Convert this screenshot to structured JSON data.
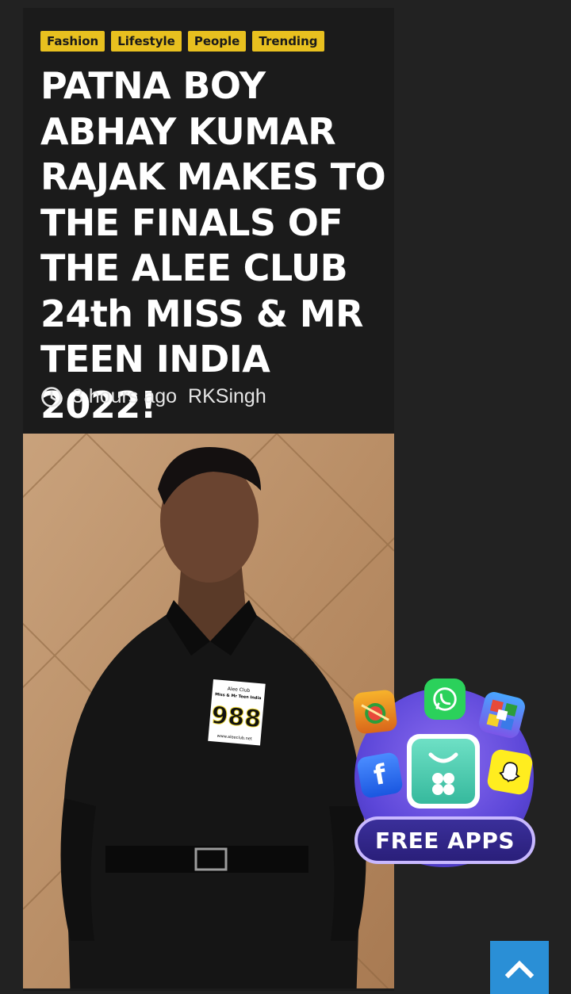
{
  "article": {
    "categories": [
      "Fashion",
      "Lifestyle",
      "People",
      "Trending"
    ],
    "title": "PATNA BOY ABHAY KUMAR RAJAK MAKES TO THE FINALS OF THE ALEE CLUB 24th MISS & MR TEEN INDIA 2022!",
    "time_ago": "3 hours ago",
    "author": "RKSingh",
    "badge": {
      "club": "Alee Club",
      "event": "Miss & Mr Teen India",
      "number": "988",
      "site": "www.aleeclub.net"
    }
  },
  "ad": {
    "label": "FREE APPS",
    "icons": [
      "whatsapp-icon",
      "fruit-ninja-icon",
      "ludo-icon",
      "facebook-icon",
      "snapchat-icon",
      "app-store-icon"
    ]
  },
  "colors": {
    "tag_bg": "#e8c01f",
    "card_bg": "#1b1b1b",
    "page_bg": "#222222",
    "scroll_button": "#2a8fd6"
  },
  "icons": {
    "meta_time": "clock-icon",
    "scroll_top": "chevron-up-icon"
  }
}
